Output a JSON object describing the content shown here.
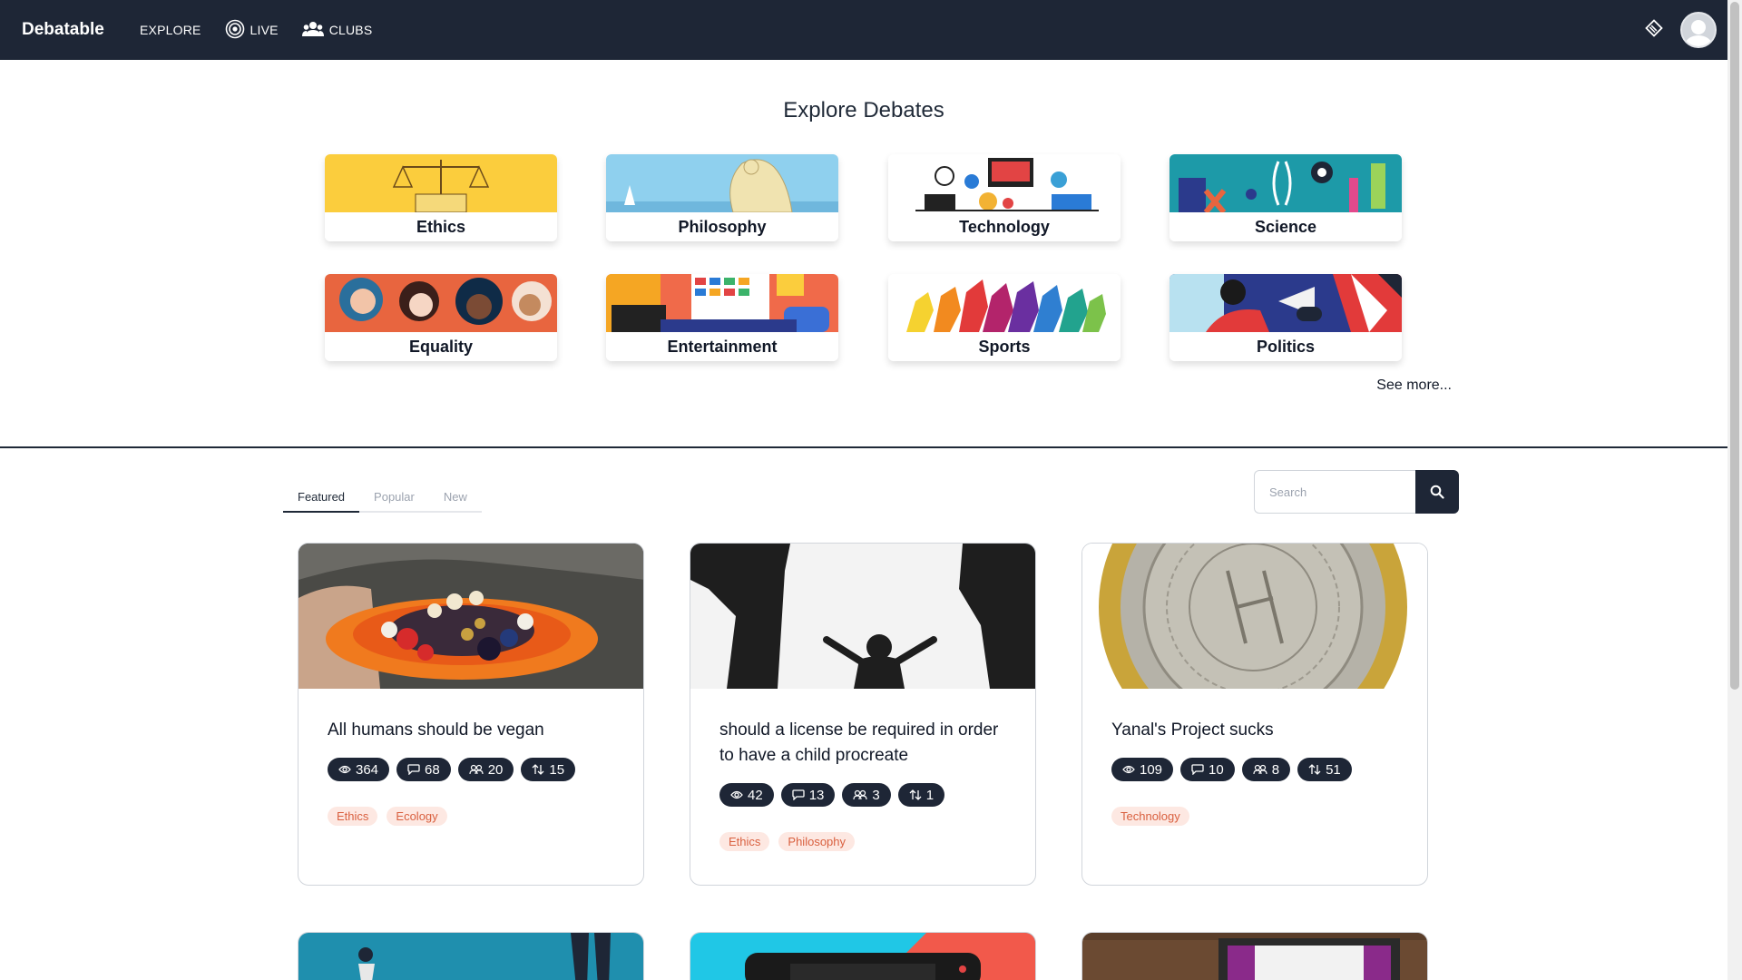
{
  "nav": {
    "brand": "Debatable",
    "explore": "EXPLORE",
    "live": "LIVE",
    "clubs": "CLUBS"
  },
  "explore": {
    "title": "Explore Debates",
    "see_more": "See more...",
    "categories": [
      {
        "label": "Ethics",
        "color": "#fbcd3d"
      },
      {
        "label": "Philosophy",
        "color": "#8fd0ee"
      },
      {
        "label": "Technology",
        "color": "#ffffff"
      },
      {
        "label": "Science",
        "color": "#1d9aa8"
      },
      {
        "label": "Equality",
        "color": "#e8653f"
      },
      {
        "label": "Entertainment",
        "color": "#f06a4a"
      },
      {
        "label": "Sports",
        "color": "#ffffff"
      },
      {
        "label": "Politics",
        "color": "#2b3a8c"
      }
    ]
  },
  "tabs": [
    "Featured",
    "Popular",
    "New"
  ],
  "search": {
    "placeholder": "Search"
  },
  "debates": [
    {
      "title": "All humans should be vegan",
      "views": "364",
      "comments": "68",
      "participants": "20",
      "votes": "15",
      "tags": [
        "Ethics",
        "Ecology"
      ]
    },
    {
      "title": "should a license be required in order to have a child procreate",
      "views": "42",
      "comments": "13",
      "participants": "3",
      "votes": "1",
      "tags": [
        "Ethics",
        "Philosophy"
      ]
    },
    {
      "title": "Yanal's Project sucks",
      "views": "109",
      "comments": "10",
      "participants": "8",
      "votes": "51",
      "tags": [
        "Technology"
      ]
    }
  ],
  "colors": {
    "navbar": "#1e2636",
    "tag_bg": "#fde8e2",
    "tag_text": "#d9603f",
    "badge": "#1e2636"
  }
}
